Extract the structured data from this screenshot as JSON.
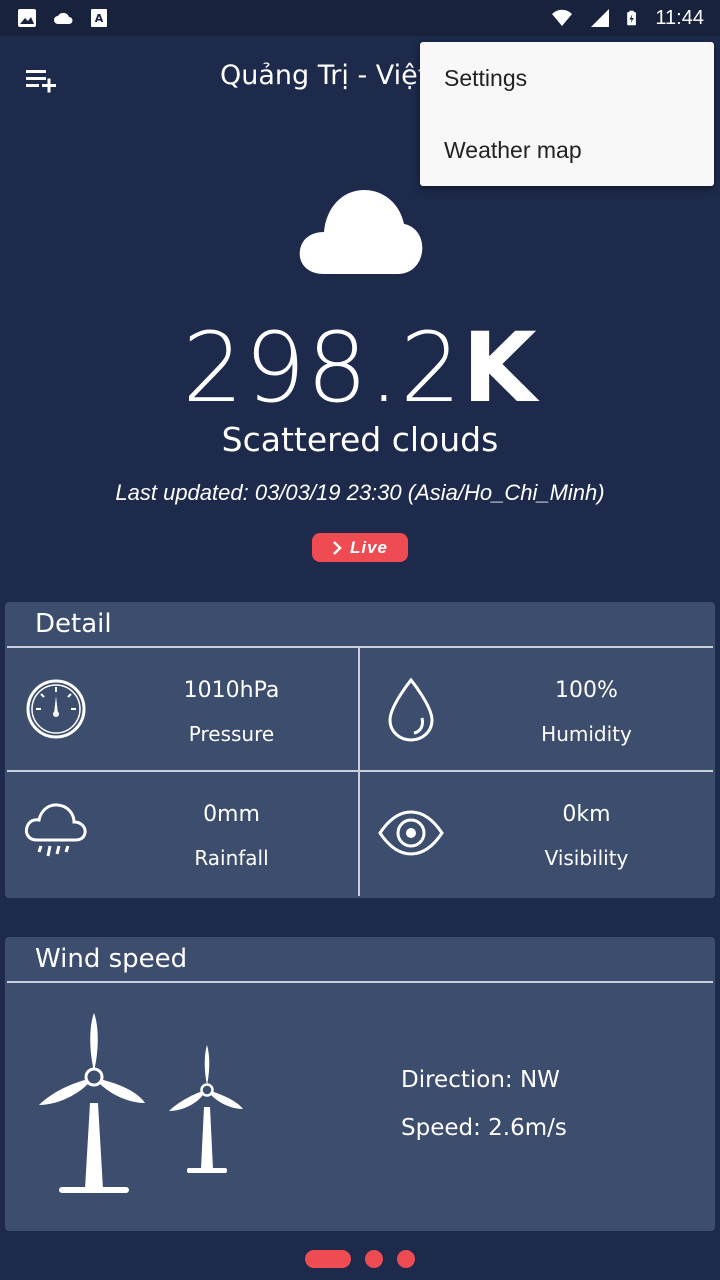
{
  "status_bar": {
    "time": "11:44",
    "left_icons": [
      "image-icon",
      "cloud-icon",
      "font-a-icon"
    ],
    "right_icons": [
      "wifi-icon",
      "signal-icon",
      "battery-charging-icon"
    ]
  },
  "toolbar": {
    "title": "Quảng Trị - Việt Nam",
    "menu_icon": "playlist-add-icon"
  },
  "popup_menu": {
    "items": [
      "Settings",
      "Weather map"
    ]
  },
  "weather": {
    "condition_icon": "cloud-icon",
    "temperature_value": "298.2",
    "temperature_unit": "K",
    "condition": "Scattered clouds",
    "last_updated": "Last updated: 03/03/19 23:30 (Asia/Ho_Chi_Minh)",
    "live_label": "Live"
  },
  "detail": {
    "title": "Detail",
    "pressure": {
      "value": "1010hPa",
      "label": "Pressure",
      "icon": "gauge-icon"
    },
    "humidity": {
      "value": "100%",
      "label": "Humidity",
      "icon": "water-drop-icon"
    },
    "rainfall": {
      "value": "0mm",
      "label": "Rainfall",
      "icon": "rain-cloud-icon"
    },
    "visibility": {
      "value": "0km",
      "label": "Visibility",
      "icon": "eye-icon"
    }
  },
  "wind": {
    "title": "Wind speed",
    "direction": "Direction: NW",
    "speed": "Speed: 2.6m/s",
    "icon": "wind-turbine-icon"
  },
  "pager": {
    "pages": 3,
    "active_index": 0
  },
  "colors": {
    "background": "#1d2a4b",
    "card": "#3d4d6e",
    "accent": "#ee4b52",
    "menu_background": "#f8f8f8"
  }
}
